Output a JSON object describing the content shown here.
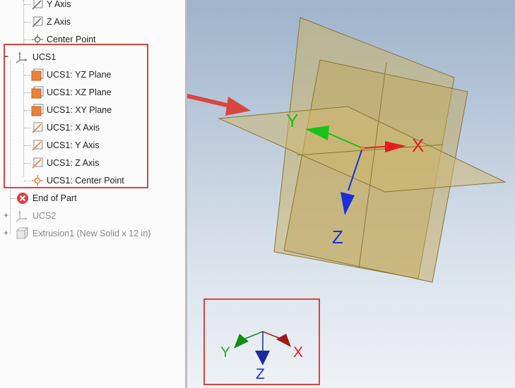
{
  "tree": {
    "items": [
      {
        "label": "Y Axis",
        "icon": "axis-icon"
      },
      {
        "label": "Z Axis",
        "icon": "axis-icon"
      },
      {
        "label": "Center Point",
        "icon": "center-point-icon"
      },
      {
        "label": "UCS1",
        "icon": "ucs-icon",
        "expander": "−"
      },
      {
        "label": "UCS1: YZ Plane",
        "icon": "plane-icon"
      },
      {
        "label": "UCS1: XZ Plane",
        "icon": "plane-icon"
      },
      {
        "label": "UCS1: XY Plane",
        "icon": "plane-icon"
      },
      {
        "label": "UCS1: X Axis",
        "icon": "axis-icon"
      },
      {
        "label": "UCS1: Y Axis",
        "icon": "axis-icon"
      },
      {
        "label": "UCS1: Z Axis",
        "icon": "axis-icon"
      },
      {
        "label": "UCS1: Center Point",
        "icon": "center-point-icon"
      },
      {
        "label": "End of Part",
        "icon": "end-of-part-icon"
      },
      {
        "label": "UCS2",
        "icon": "ucs-icon",
        "expander": "+"
      },
      {
        "label": "Extrusion1 (New Solid x 12 in)",
        "icon": "extrusion-icon",
        "expander": "+"
      }
    ]
  },
  "viewport": {
    "axis_labels": {
      "x": "X",
      "y": "Y",
      "z": "Z"
    },
    "triad_labels": {
      "x": "X",
      "y": "Y",
      "z": "Z"
    }
  },
  "colors": {
    "highlight": "#d9453f",
    "x_axis": "#e02020",
    "y_axis": "#19c219",
    "z_axis": "#1c2fd6",
    "plane_fill": "#c9b26a",
    "plane_edge": "#8a7430",
    "ucs_icon_orange": "#e8823a"
  }
}
